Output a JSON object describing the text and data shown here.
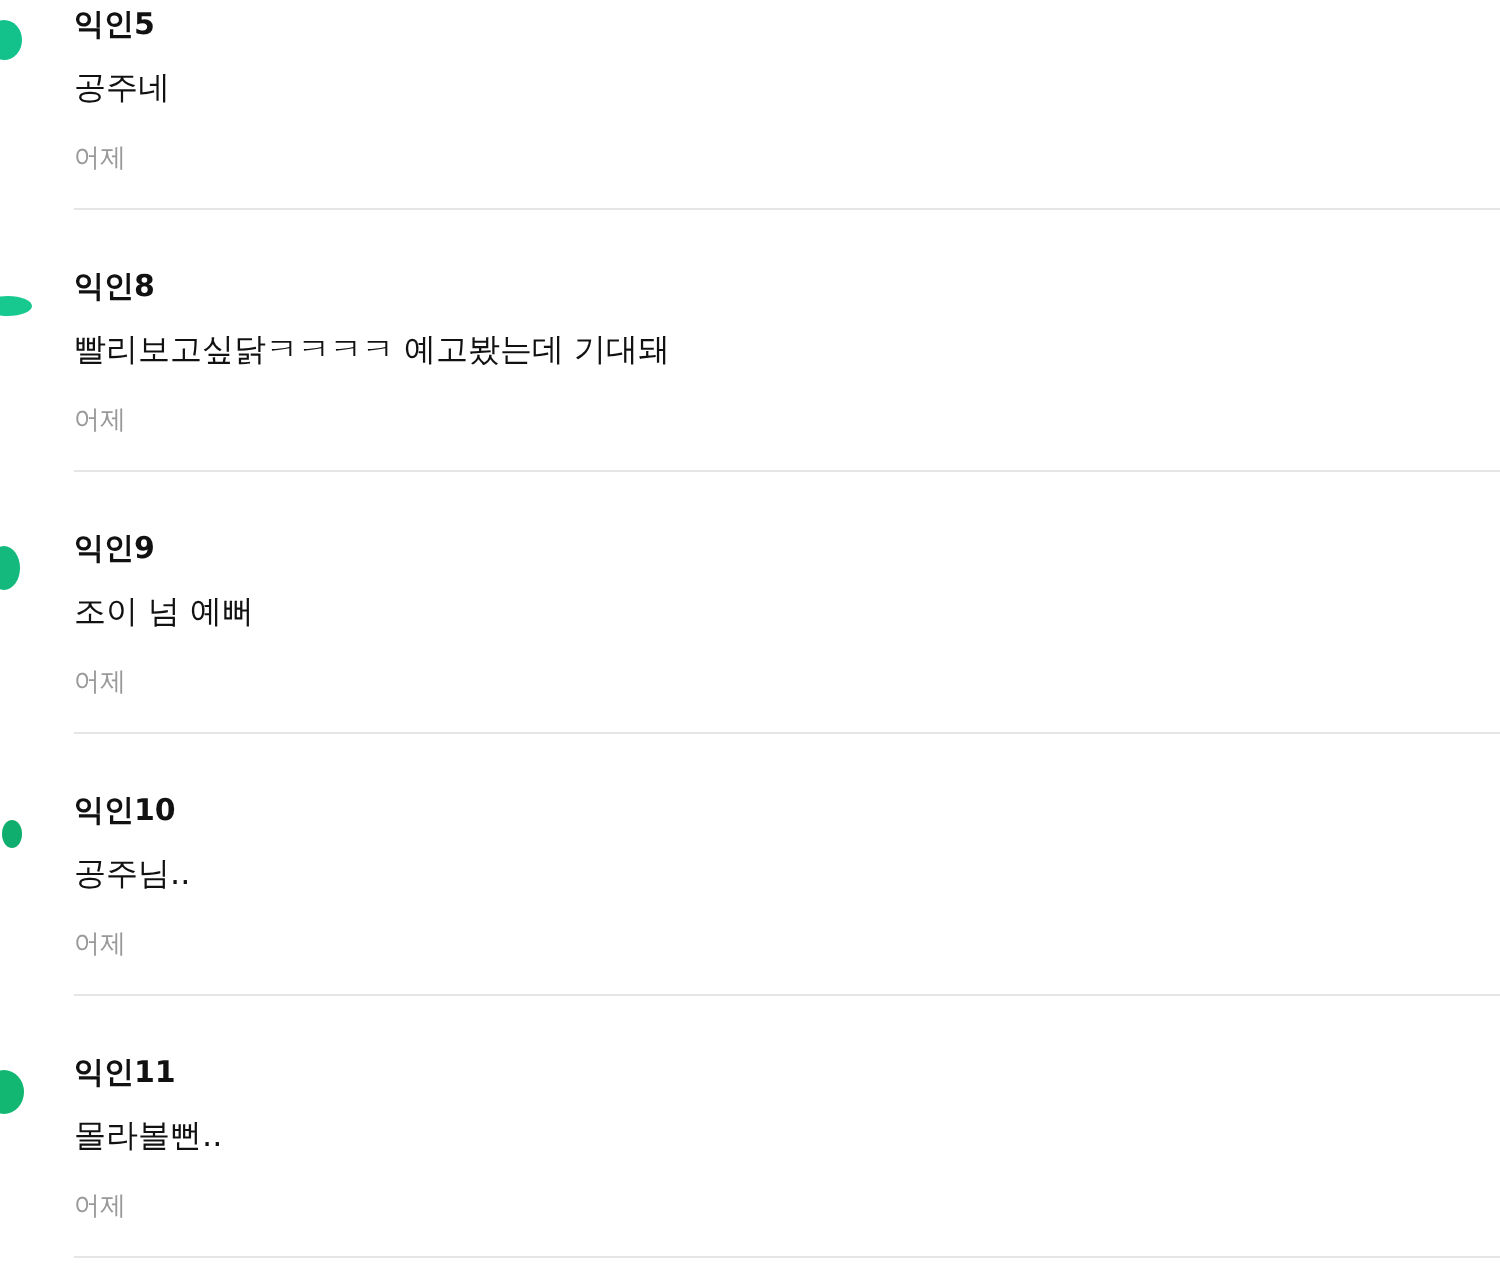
{
  "comments": [
    {
      "author": "익인5",
      "text": "공주네",
      "time": "어제"
    },
    {
      "author": "익인8",
      "text": "빨리보고싶닭ㅋㅋㅋㅋ 예고봤는데 기대돼",
      "time": "어제"
    },
    {
      "author": "익인9",
      "text": "조이 넘 예뻐",
      "time": "어제"
    },
    {
      "author": "익인10",
      "text": "공주님..",
      "time": "어제"
    },
    {
      "author": "익인11",
      "text": "몰라볼뻔..",
      "time": "어제"
    }
  ]
}
